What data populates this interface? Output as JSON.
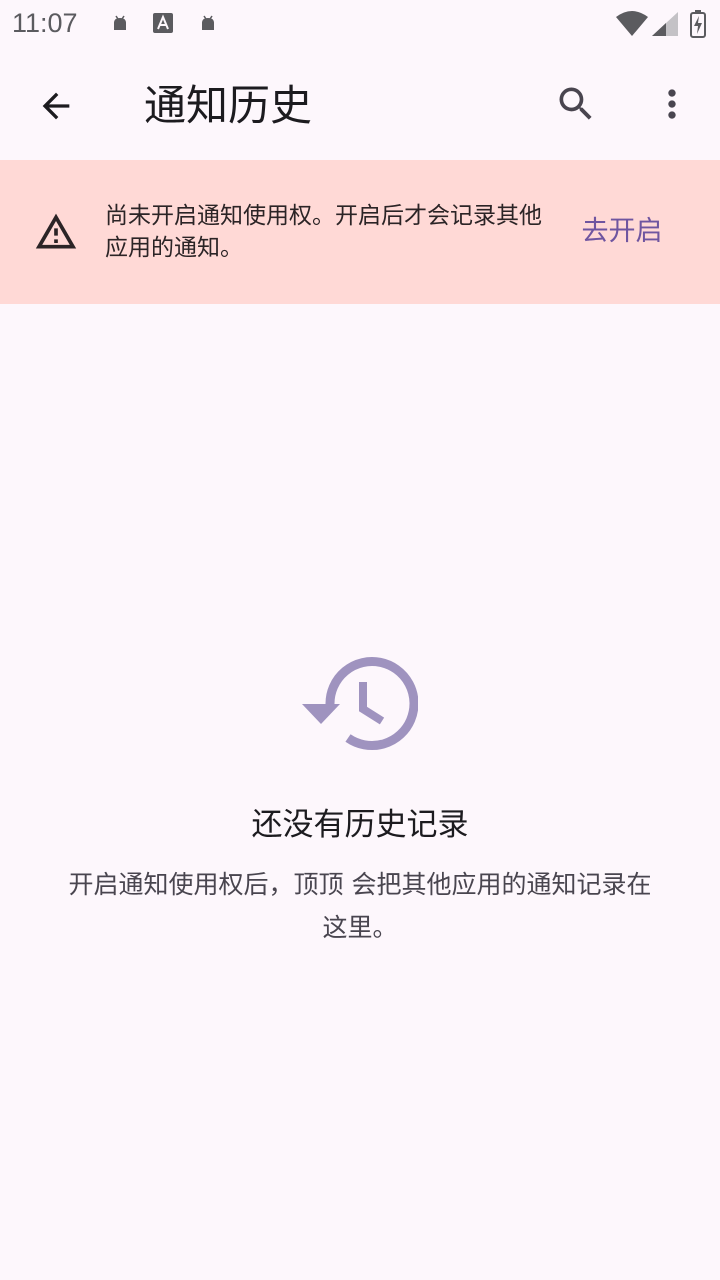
{
  "status_bar": {
    "time": "11:07"
  },
  "app_bar": {
    "title": "通知历史",
    "back_icon": "arrow-back-icon",
    "search_icon": "search-icon",
    "more_icon": "more-vert-icon"
  },
  "banner": {
    "message": "尚未开启通知使用权。开启后才会记录其他应用的通知。",
    "action_label": "去开启",
    "icon": "warning-icon",
    "background_color": "#ffd9d6",
    "action_color": "#6f55a0"
  },
  "empty_state": {
    "icon": "history-icon",
    "icon_color": "#9f93bf",
    "title": "还没有历史记录",
    "description": "开启通知使用权后，顶顶 会把其他应用的通知记录在这里。"
  }
}
